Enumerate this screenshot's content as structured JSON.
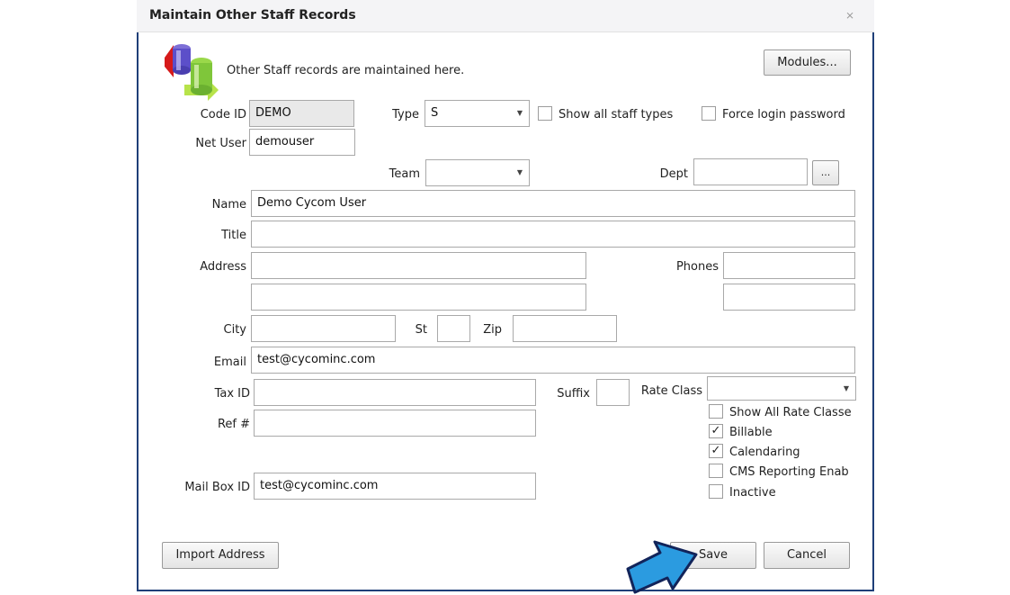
{
  "dialog": {
    "title": "Maintain Other Staff Records",
    "close_glyph": "⨯"
  },
  "header": {
    "description": "Other Staff records are maintained here.",
    "modules_label": "Modules..."
  },
  "fields": {
    "code_id": {
      "label": "Code ID",
      "value": "DEMO"
    },
    "type": {
      "label": "Type",
      "value": "S"
    },
    "show_all_staff_types": {
      "label": "Show all staff types",
      "checked": false
    },
    "force_login_password": {
      "label": "Force login password",
      "checked": false
    },
    "net_user": {
      "label": "Net User",
      "value": "demouser"
    },
    "team": {
      "label": "Team",
      "value": ""
    },
    "dept": {
      "label": "Dept",
      "value": "",
      "browse_label": "..."
    },
    "name": {
      "label": "Name",
      "value": "Demo Cycom User"
    },
    "title": {
      "label": "Title",
      "value": ""
    },
    "address": {
      "label": "Address",
      "line1": "",
      "line2": ""
    },
    "phones": {
      "label": "Phones",
      "phone1": "",
      "phone2": ""
    },
    "city": {
      "label": "City",
      "value": ""
    },
    "st": {
      "label": "St",
      "value": ""
    },
    "zip": {
      "label": "Zip",
      "value": ""
    },
    "email": {
      "label": "Email",
      "value": "test@cycominc.com"
    },
    "tax_id": {
      "label": "Tax ID",
      "value": ""
    },
    "suffix": {
      "label": "Suffix",
      "value": ""
    },
    "rate_class": {
      "label": "Rate Class",
      "value": ""
    },
    "ref": {
      "label": "Ref #",
      "value": ""
    },
    "mail_box_id": {
      "label": "Mail Box ID",
      "value": "test@cycominc.com"
    }
  },
  "options": [
    {
      "label": "Show All Rate Classe",
      "checked": false,
      "glyph": ""
    },
    {
      "label": "Billable",
      "checked": true,
      "glyph": "✓"
    },
    {
      "label": "Calendaring",
      "checked": true,
      "glyph": "✓"
    },
    {
      "label": "CMS Reporting Enab",
      "checked": false,
      "glyph": ""
    },
    {
      "label": "Inactive",
      "checked": false,
      "glyph": ""
    }
  ],
  "footer": {
    "import_address": "Import Address",
    "save": "Save",
    "cancel": "Cancel"
  },
  "colors": {
    "border": "#1f3f78",
    "arrow": "#2b9be0",
    "arrow_outline": "#12245a"
  }
}
